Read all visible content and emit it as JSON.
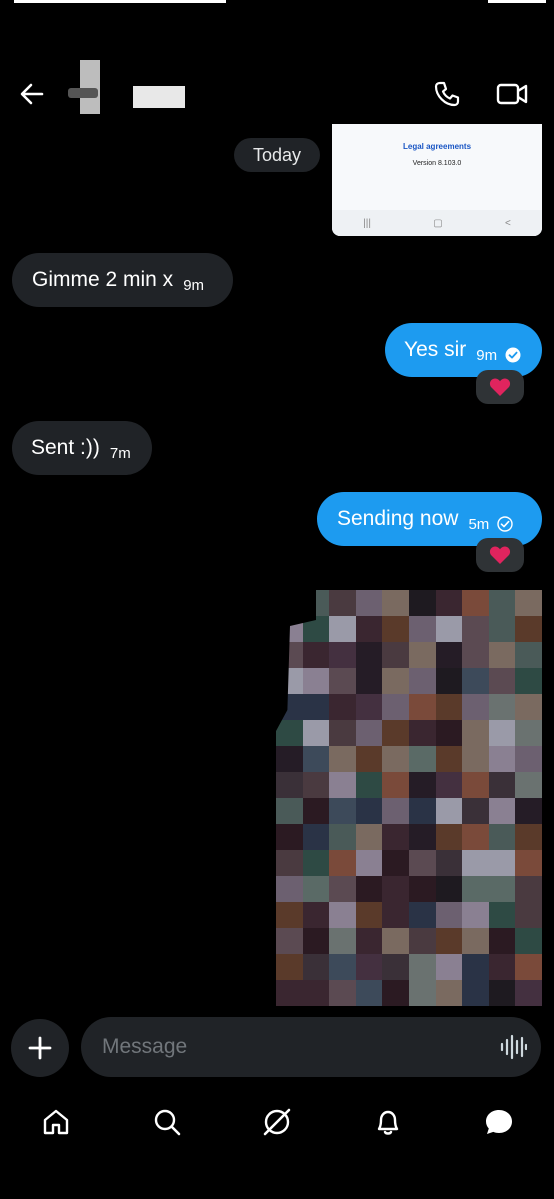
{
  "header": {
    "back_icon": "arrow-left-icon",
    "call_icon": "phone-icon",
    "video_icon": "video-camera-icon"
  },
  "shared_screenshot": {
    "title": "Legal agreements",
    "version": "Version 8.103.0",
    "nav_icons": [
      "|||",
      "▢",
      "<"
    ]
  },
  "date_separator": "Today",
  "messages": [
    {
      "direction": "incoming",
      "text": "Gimme 2 min x",
      "time": "9m"
    },
    {
      "direction": "outgoing",
      "text": "Yes sir",
      "time": "9m",
      "status": "seen",
      "reaction": "heart"
    },
    {
      "direction": "incoming",
      "text": "Sent :))",
      "time": "7m"
    },
    {
      "direction": "outgoing",
      "text": "Sending now",
      "time": "5m",
      "status": "sent",
      "reaction": "heart"
    }
  ],
  "composer": {
    "placeholder": "Message",
    "add_icon": "plus-icon",
    "voice_icon": "voice-waveform-icon"
  },
  "bottom_nav": [
    "home-icon",
    "search-icon",
    "grok-icon",
    "notifications-bell-icon",
    "messages-icon"
  ],
  "colors": {
    "accent": "#1d9bf0",
    "incoming_bubble": "#202327",
    "background": "#000000",
    "reaction_heart": "#e0245e"
  }
}
